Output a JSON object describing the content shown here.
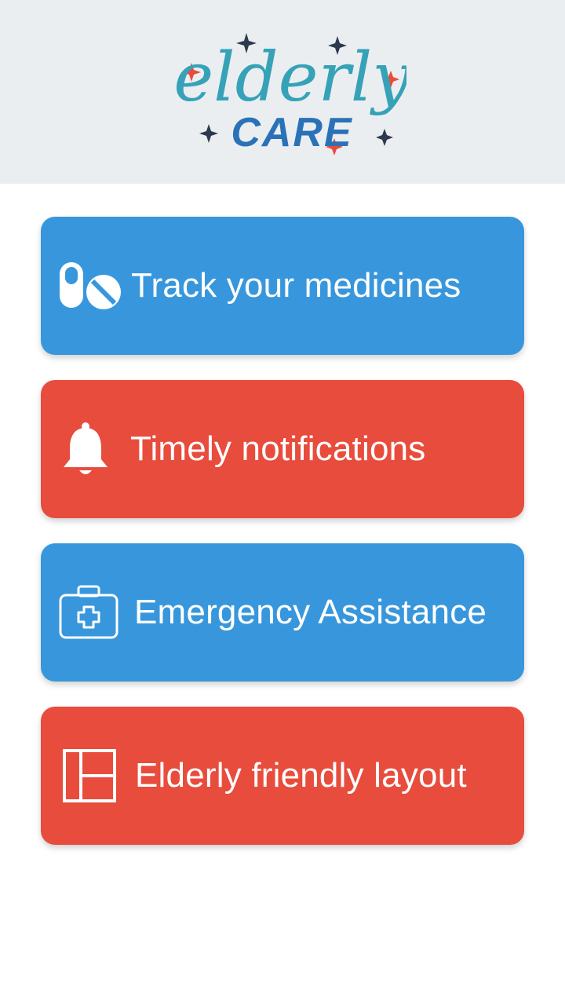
{
  "header": {
    "logo_text_script": "elderly",
    "logo_text_caps": "CARE"
  },
  "colors": {
    "blue": "#3897dc",
    "red": "#e84c3d",
    "header_bg": "#ebeef0"
  },
  "features": [
    {
      "label": "Track your medicines",
      "icon": "pills-icon",
      "color": "#3897dc"
    },
    {
      "label": "Timely notifications",
      "icon": "bell-icon",
      "color": "#e84c3d"
    },
    {
      "label": "Emergency Assistance",
      "icon": "medical-kit-icon",
      "color": "#3897dc"
    },
    {
      "label": "Elderly friendly layout",
      "icon": "layout-icon",
      "color": "#e84c3d"
    }
  ]
}
